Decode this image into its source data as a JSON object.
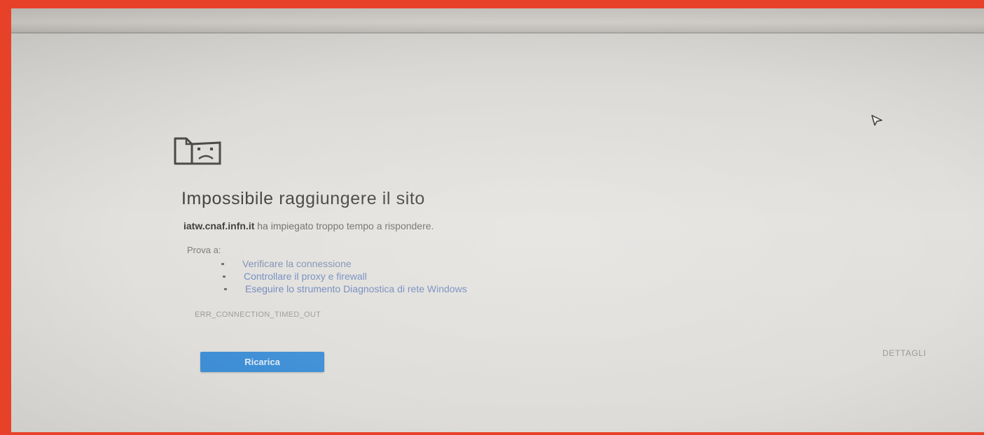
{
  "error_page": {
    "title": "Impossibile raggiungere il sito",
    "host": "iatw.cnaf.infn.it",
    "message_rest": " ha impiegato troppo tempo a rispondere.",
    "try_label": "Prova a:",
    "suggestions": [
      "Verificare la connessione",
      "Controllare il proxy e firewall",
      "Eseguire lo strumento Diagnostica di rete Windows"
    ],
    "error_code": "ERR_CONNECTION_TIMED_OUT",
    "reload_label": "Ricarica",
    "details_label": "DETTAGLI"
  },
  "icons": {
    "error_icon": "sad-page-icon",
    "cursor": "mouse-pointer-icon"
  },
  "colors": {
    "frame_red": "#e8412a",
    "button_blue": "#3f8fd6",
    "link_blue": "#7c8fb4",
    "title_gray": "#3f3f3f"
  }
}
